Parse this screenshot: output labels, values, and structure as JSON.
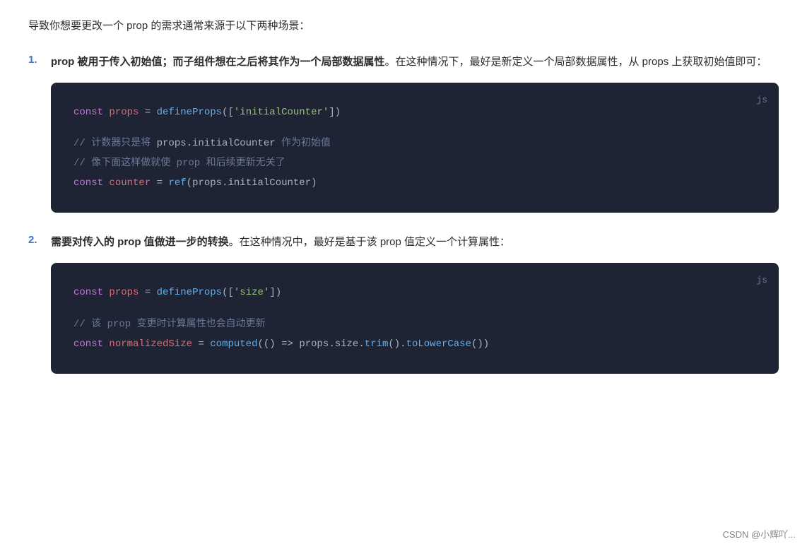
{
  "intro": {
    "text": "导致你想要更改一个 prop 的需求通常来源于以下两种场景："
  },
  "items": [
    {
      "number": "1.",
      "description_bold": "prop 被用于传入初始值；而子组件想在之后将其作为一个局部数据属性",
      "description_rest": "。在这种情况下，最好是新定义一个局部数据属性，从 props 上获取初始值即可：",
      "code": {
        "lang": "js",
        "lines": [
          {
            "type": "code",
            "content": "const props = defineProps(['initialCounter'])"
          },
          {
            "type": "empty"
          },
          {
            "type": "comment",
            "content": "// 计数器只是将 props.initialCounter 作为初始值"
          },
          {
            "type": "comment",
            "content": "// 像下面这样做就使 prop 和后续更新无关了"
          },
          {
            "type": "code",
            "content": "const counter = ref(props.initialCounter)"
          }
        ]
      }
    },
    {
      "number": "2.",
      "description_bold": "需要对传入的 prop 值做进一步的转换",
      "description_rest": "。在这种情况中，最好是基于该 prop 值定义一个计算属性：",
      "code": {
        "lang": "js",
        "lines": [
          {
            "type": "code",
            "content": "const props = defineProps(['size'])"
          },
          {
            "type": "empty"
          },
          {
            "type": "comment",
            "content": "// 该 prop 变更时计算属性也会自动更新"
          },
          {
            "type": "code",
            "content": "const normalizedSize = computed(() => props.size.trim().toLowerCase())"
          }
        ]
      }
    }
  ],
  "watermark": "CSDN @小辉吖..."
}
